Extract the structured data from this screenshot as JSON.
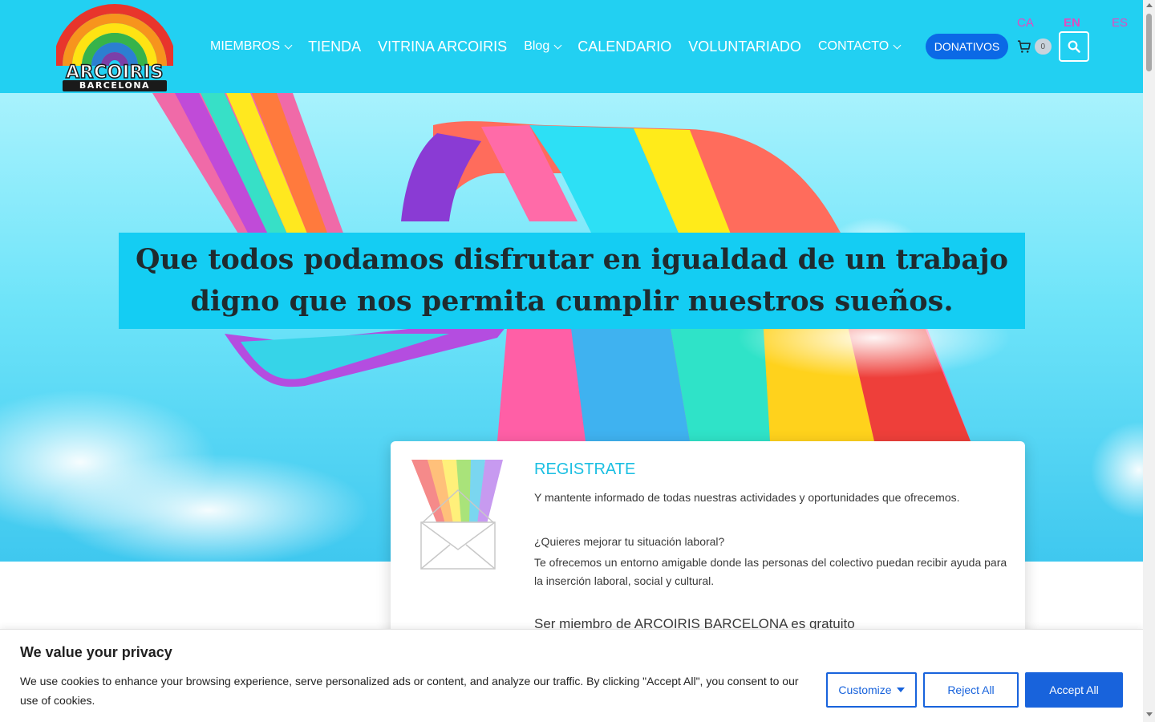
{
  "logo": {
    "line1": "ARCOIRIS",
    "line2": "BARCELONA"
  },
  "nav": {
    "items": [
      {
        "label": "MIEMBROS",
        "dropdown": true
      },
      {
        "label": "TIENDA",
        "dropdown": false
      },
      {
        "label": "VITRINA ARCOIRIS",
        "dropdown": false
      },
      {
        "label": "Blog",
        "dropdown": true
      },
      {
        "label": "CALENDARIO",
        "dropdown": false
      },
      {
        "label": "VOLUNTARIADO",
        "dropdown": false
      },
      {
        "label": "CONTACTO",
        "dropdown": true
      }
    ],
    "donate_label": "DONATIVOS",
    "cart_count": "0"
  },
  "languages": [
    {
      "code": "CA",
      "active": false
    },
    {
      "code": "EN",
      "active": true
    },
    {
      "code": "ES",
      "active": false
    }
  ],
  "hero": {
    "headline": "Que todos podamos disfrutar en igualdad de un trabajo digno que nos permita cumplir nuestros sueños."
  },
  "register": {
    "title": "REGISTRATE",
    "p1": "Y mantente informado de todas nuestras actividades y oportunidades que ofrecemos.",
    "p2": "¿Quieres mejorar tu situación laboral?",
    "p3": "Te ofrecemos un entorno amigable donde las personas del colectivo puedan recibir ayuda para la inserción laboral, social y cultural.",
    "p4": "Ser miembro de ARCOIRIS BARCELONA es gratuito"
  },
  "cookie": {
    "title": "We value your privacy",
    "text": "We use cookies to enhance your browsing experience, serve personalized ads or content, and analyze our traffic. By clicking \"Accept All\", you consent to our use of cookies.",
    "customize": "Customize",
    "reject": "Reject All",
    "accept": "Accept All"
  },
  "colors": {
    "header_bg": "#22d0f2",
    "donate_bg": "#0b69e6",
    "lang_color": "#e04cc0",
    "headline_box": "#14cdf3",
    "register_title": "#1bbfe2",
    "cookie_accent": "#1863dc"
  },
  "icons": [
    "rainbow-logo",
    "chevron-down-icon",
    "cart-icon",
    "search-icon",
    "envelope-rainbow-icon",
    "caret-down-icon"
  ]
}
